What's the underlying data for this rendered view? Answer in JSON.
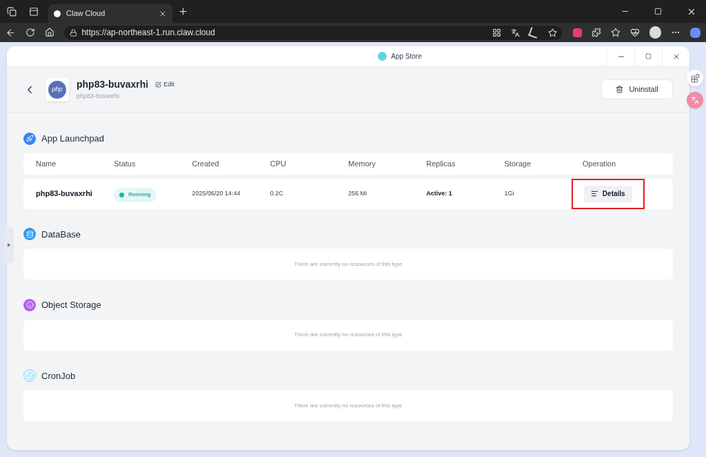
{
  "browser": {
    "tab": {
      "title": "Claw Cloud"
    },
    "url": "https://ap-northeast-1.run.claw.cloud"
  },
  "window": {
    "title": "App Store"
  },
  "app": {
    "name": "php83-buvaxrhi",
    "subtitle": "php83-buvaxrhi",
    "logo_text": "php",
    "edit_label": "Edit",
    "uninstall_label": "Uninstall"
  },
  "sections": [
    {
      "kind": "table",
      "title": "App Launchpad",
      "columns": [
        "Name",
        "Status",
        "Created",
        "CPU",
        "Memory",
        "Replicas",
        "Storage",
        "Operation"
      ],
      "rows": [
        {
          "name": "php83-buvaxrhi",
          "status": "Running",
          "created": "2025/06/20 14:44",
          "cpu": "0.2C",
          "memory": "256 Mi",
          "replicas": "Active: 1",
          "storage": "1Gi",
          "action": "Details",
          "highlighted": true
        }
      ]
    },
    {
      "kind": "empty",
      "title": "DataBase",
      "message": "There are currently no resources of this type"
    },
    {
      "kind": "empty",
      "title": "Object Storage",
      "message": "There are currently no resources of this type"
    },
    {
      "kind": "empty",
      "title": "CronJob",
      "message": "There are currently no resources of this type"
    }
  ]
}
